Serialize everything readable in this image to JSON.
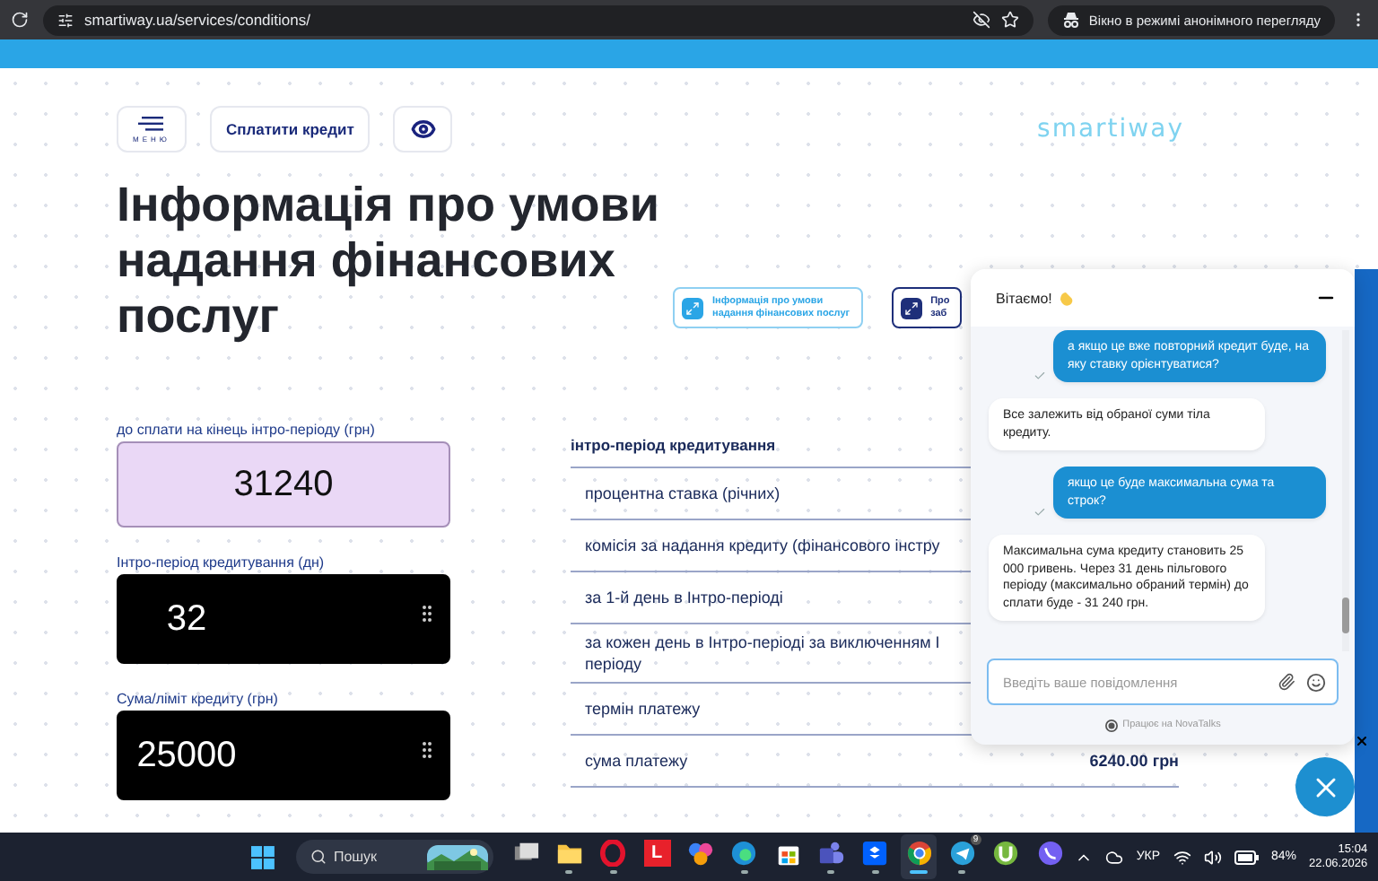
{
  "browser": {
    "url": "smartiway.ua/services/conditions/",
    "incognito_label": "Вікно в режимі анонімного перегляду"
  },
  "header": {
    "menu_label": "МЕНЮ",
    "pay_button": "Сплатити кредит",
    "logo": "smartiway"
  },
  "title": "Інформація про умови надання фінансових послуг",
  "doc_tabs": [
    {
      "lines": [
        "Інформація про умови",
        "надання фінансових послуг"
      ],
      "selected": true
    },
    {
      "lines": [
        "Про",
        "заб"
      ],
      "selected": false
    }
  ],
  "calculator": {
    "fields": [
      {
        "label": "до сплати на кінець інтро-періоду (грн)",
        "value": "31240",
        "kind": "result"
      },
      {
        "label": "Інтро-період кредитування (дн)",
        "value": "32",
        "kind": "input"
      },
      {
        "label": "Сума/ліміт кредиту (грн)",
        "value": "25000",
        "kind": "input"
      }
    ]
  },
  "table": {
    "heading": "інтро-період кредитування",
    "rows": [
      {
        "label": "процентна ставка (річних)"
      },
      {
        "label": "комісія за надання кредиту (фінансового інстру"
      },
      {
        "label": "за 1-й день в Інтро-періоді"
      },
      {
        "label": "за кожен день в Інтро-періоді за виключенням І періоду"
      },
      {
        "label": "термін платежу"
      },
      {
        "label": "сума платежу",
        "value": "6240.00 грн"
      }
    ]
  },
  "chat": {
    "title": "Вітаємо!",
    "messages": [
      {
        "kind": "user",
        "text": "а якщо це вже повторний кредит буде, на яку ставку орієнтуватися?"
      },
      {
        "kind": "bot",
        "text": "Все залежить від обраної суми тіла кредиту."
      },
      {
        "kind": "user",
        "text": "якщо це буде максимальна сума та строк?"
      },
      {
        "kind": "bot",
        "text": "Максимальна сума кредиту становить 25 000 гривень. Через 31 день пільгового періоду (максимально обраний термін) до сплати буде - 31 240 грн."
      }
    ],
    "placeholder": "Введіть ваше повідомлення",
    "powered_by": "Працює на NovaTalks"
  },
  "taskbar": {
    "search_placeholder": "Пошук",
    "apps": [
      {
        "kind": "taskview",
        "running": false,
        "active": false
      },
      {
        "kind": "folder",
        "running": true,
        "active": false
      },
      {
        "kind": "ring",
        "running": true,
        "active": false
      },
      {
        "kind": "letter",
        "label": "L",
        "running": false,
        "active": false
      },
      {
        "kind": "flower",
        "running": false,
        "active": false
      },
      {
        "kind": "swirl",
        "running": true,
        "active": false
      },
      {
        "kind": "store",
        "running": false,
        "active": false
      },
      {
        "kind": "people",
        "running": true,
        "active": false
      },
      {
        "kind": "box",
        "running": true,
        "active": false
      },
      {
        "kind": "chrome",
        "running": true,
        "active": true
      },
      {
        "kind": "plane",
        "badge": "9",
        "running": true,
        "active": false
      },
      {
        "kind": "torrent",
        "running": false,
        "active": false
      },
      {
        "kind": "phone",
        "running": false,
        "active": false
      }
    ],
    "language": "УКР",
    "battery": "84%",
    "time": "15:04",
    "date": "22.06.2026"
  }
}
